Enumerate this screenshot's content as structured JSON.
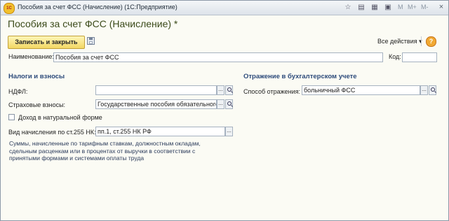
{
  "window": {
    "title": "Пособия за счет ФСС (Начисление)  (1С:Предприятие)",
    "logo_text": "1С",
    "memory_buttons": [
      "M",
      "M+",
      "M-"
    ],
    "icons": [
      "favorite-icon",
      "print-icon",
      "calculator-icon",
      "calendar-icon",
      "restore-icon",
      "close-icon"
    ]
  },
  "form": {
    "title": "Пособия за счет ФСС (Начисление) *",
    "toolbar": {
      "save_close_label": "Записать и закрыть",
      "all_actions_label": "Все действия ▾",
      "help_label": "?"
    },
    "name": {
      "label": "Наименование:",
      "value": "Пособия за счет ФСС"
    },
    "code": {
      "label": "Код:",
      "value": ""
    },
    "taxes": {
      "heading": "Налоги и взносы",
      "ndfl": {
        "label": "НДФЛ:",
        "value": ""
      },
      "insurance": {
        "label": "Страховые взносы:",
        "value": "Государственные пособия обязательного"
      },
      "in_kind": {
        "label": "Доход в натуральной форме",
        "checked": false
      },
      "accrual_type": {
        "label": "Вид начисления по ст.255 НК:",
        "value": "пп.1, ст.255 НК РФ"
      },
      "hint": "Суммы, начисленные по тарифным ставкам, должностным окладам, сдельным расценкам или в процентах от выручки в соответствии с принятыми формами и системами оплаты труда"
    },
    "accounting": {
      "heading": "Отражение в бухгалтерском учете",
      "method": {
        "label": "Способ отражения:",
        "value": "больничный ФСС"
      }
    },
    "button_ellipsis": "..."
  }
}
